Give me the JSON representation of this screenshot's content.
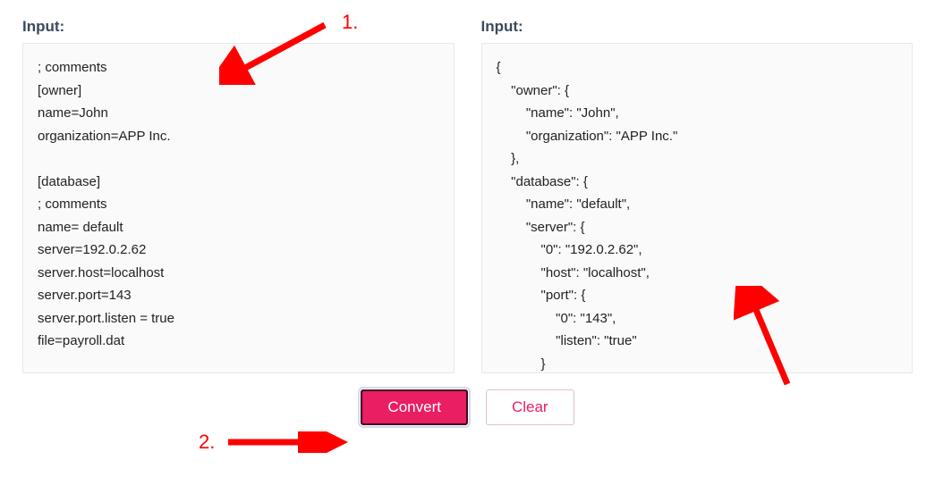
{
  "left": {
    "label": "Input:",
    "content": "; comments\n[owner]\nname=John\norganization=APP Inc.\n\n[database]\n; comments\nname= default\nserver=192.0.2.62\nserver.host=localhost\nserver.port=143\nserver.port.listen = true\nfile=payroll.dat"
  },
  "right": {
    "label": "Input:",
    "content": "{\n    \"owner\": {\n        \"name\": \"John\",\n        \"organization\": \"APP Inc.\"\n    },\n    \"database\": {\n        \"name\": \"default\",\n        \"server\": {\n            \"0\": \"192.0.2.62\",\n            \"host\": \"localhost\",\n            \"port\": {\n                \"0\": \"143\",\n                \"listen\": \"true\"\n            }\n        }"
  },
  "buttons": {
    "convert": "Convert",
    "clear": "Clear"
  },
  "annotations": {
    "one": "1.",
    "two": "2."
  }
}
